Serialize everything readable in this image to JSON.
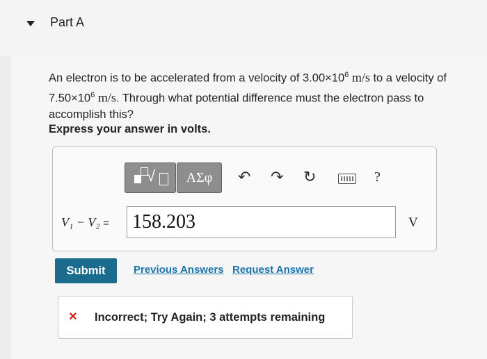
{
  "part": {
    "title": "Part A"
  },
  "question": {
    "text_1": "An electron is to be accelerated from a velocity of ",
    "v1_mantissa": "3.00×10",
    "v1_exp": "6",
    "unit_1": "m/s",
    "text_2": " to a velocity of ",
    "v2_mantissa": "7.50×10",
    "v2_exp": "6",
    "unit_2": "m/s",
    "text_3": ". Through what potential difference must the electron pass to accomplish this?",
    "instruction": "Express your answer in volts."
  },
  "toolbar": {
    "templates_icon": "templates-radical-icon",
    "symbols_label": "ΑΣφ",
    "undo_icon": "↶",
    "redo_icon": "↷",
    "reset_icon": "↻",
    "keyboard_icon": "keyboard-icon",
    "help_label": "?"
  },
  "answer": {
    "label_lhs": "V₁ − V₂",
    "label_eq": "=",
    "value": "158.203",
    "unit": "V"
  },
  "actions": {
    "submit_label": "Submit",
    "previous_answers_label": "Previous Answers",
    "request_answer_label": "Request Answer"
  },
  "feedback": {
    "icon": "×",
    "message": "Incorrect; Try Again; 3 attempts remaining"
  },
  "colors": {
    "submit_bg": "#1b6b8f",
    "link": "#1c74a8",
    "error": "#cc1a1a"
  }
}
